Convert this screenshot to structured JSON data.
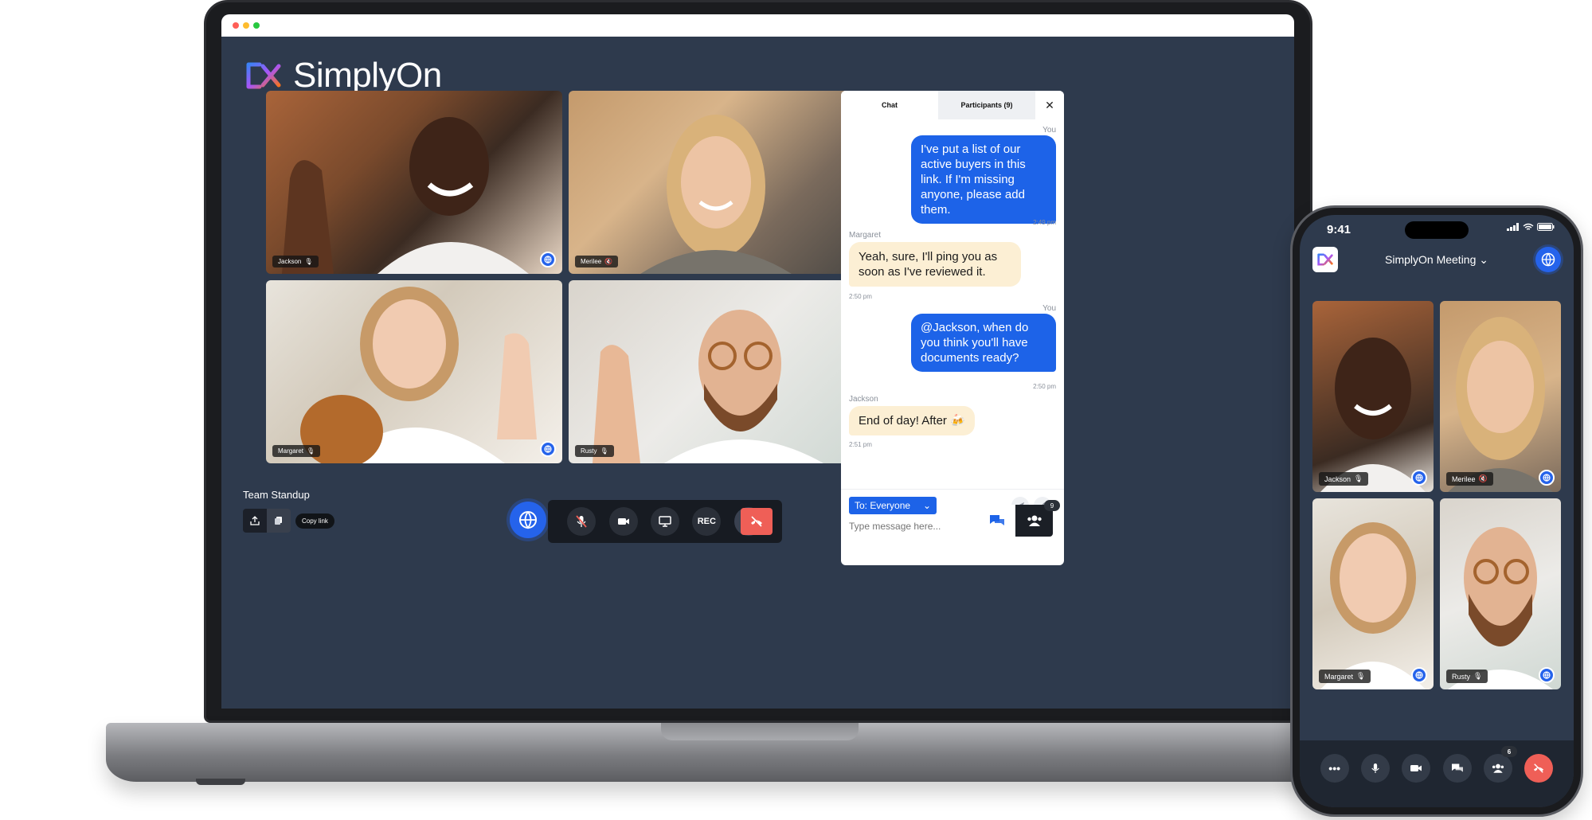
{
  "laptop": {
    "brand": "SimplyOn",
    "window_controls": [
      {
        "color": "#ff5f57"
      },
      {
        "color": "#febc2e"
      },
      {
        "color": "#28c840"
      }
    ],
    "participants": [
      {
        "name": "Jackson",
        "mic": "on"
      },
      {
        "name": "Merilee",
        "mic": "muted"
      },
      {
        "name": "Margaret",
        "mic": "on"
      },
      {
        "name": "Rusty",
        "mic": "on"
      }
    ],
    "chat": {
      "tab_chat": "Chat",
      "tab_participants": "Participants (9)",
      "close_label": "✕",
      "messages": [
        {
          "sender": "You",
          "text": "I've put a list of our active buyers in this link. If I'm missing anyone, please add them.",
          "time": "2:49 pm",
          "own": true
        },
        {
          "sender": "Margaret",
          "text": "Yeah, sure, I'll ping you as soon as I've reviewed it.",
          "time": "2:50 pm",
          "own": false
        },
        {
          "sender": "You",
          "text": "@Jackson, when do you think you'll have documents ready?",
          "time": "2:50 pm",
          "own": true
        },
        {
          "sender": "Jackson",
          "text": "End of day! After 🍻",
          "time": "2:51 pm",
          "own": false
        }
      ],
      "recipient": "To: Everyone",
      "input_placeholder": "Type message here..."
    },
    "meeting_name": "Team Standup",
    "copy_link_label": "Copy link",
    "controls": {
      "record_label": "REC",
      "participant_count": "9"
    },
    "accent_color": "#2563eb",
    "leave_color": "#ef5f57"
  },
  "phone": {
    "status_time": "9:41",
    "meeting_title": "SimplyOn Meeting ⌄",
    "participants": [
      {
        "name": "Jackson",
        "mic": "on"
      },
      {
        "name": "Merilee",
        "mic": "muted"
      },
      {
        "name": "Margaret",
        "mic": "on"
      },
      {
        "name": "Rusty",
        "mic": "on"
      }
    ],
    "more_label": "•••",
    "participant_count": "6"
  }
}
